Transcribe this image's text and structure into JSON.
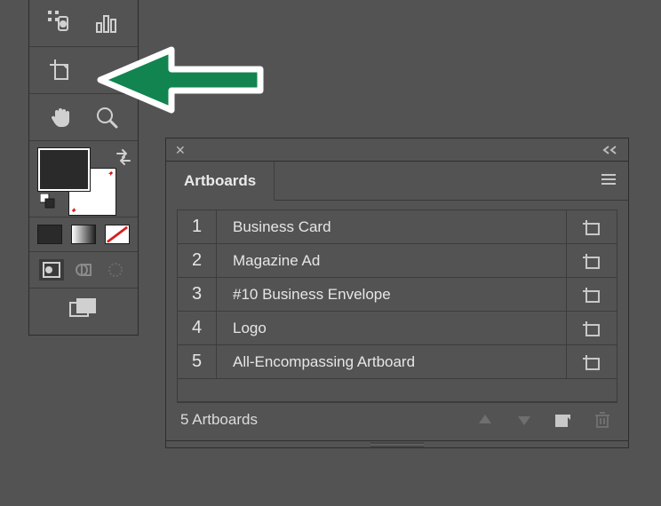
{
  "panel": {
    "title": "Artboards",
    "count_label": "5 Artboards",
    "items": [
      {
        "num": "1",
        "name": "Business Card"
      },
      {
        "num": "2",
        "name": "Magazine Ad"
      },
      {
        "num": "3",
        "name": "#10 Business Envelope"
      },
      {
        "num": "4",
        "name": "Logo"
      },
      {
        "num": "5",
        "name": "All-Encompassing Artboard"
      }
    ]
  },
  "colors": {
    "arrow": "#12844f",
    "fill": "#2a2a2a",
    "stroke": "#ffffff"
  }
}
